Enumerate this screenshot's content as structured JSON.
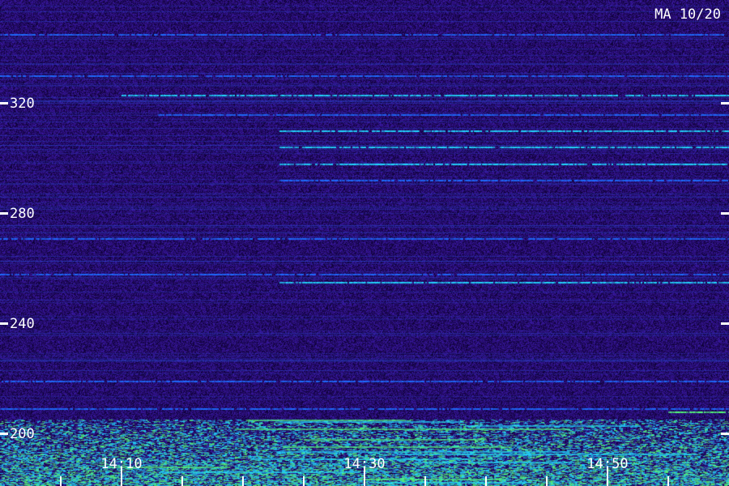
{
  "header": {
    "station_label": "MA 10/20"
  },
  "colors": {
    "background": "#20085a",
    "noise_dark": "#0a0030",
    "noise_light": "#3a1aa8",
    "band_blue": "#1e6cff",
    "band_cyan": "#22d8ff",
    "band_green": "#56ff7a",
    "axis": "#ffffff"
  },
  "chart_data": {
    "type": "heatmap",
    "title": "MA 10/20",
    "xlabel": "",
    "ylabel": "",
    "y_ticks": [
      200,
      240,
      280,
      320
    ],
    "y_range": [
      180,
      350
    ],
    "x_ticks": [
      "14:10",
      "14:30",
      "14:50"
    ],
    "x_range": [
      "14:00",
      "15:00"
    ],
    "x_minor_step_minutes": 5,
    "steady_lines": [
      {
        "freq": 345,
        "intensity": "blue",
        "start": "14:00",
        "end": "15:00"
      },
      {
        "freq": 330,
        "intensity": "blue",
        "start": "14:00",
        "end": "15:00"
      },
      {
        "freq": 323,
        "intensity": "cyan",
        "start": "14:10",
        "end": "15:00"
      },
      {
        "freq": 316,
        "intensity": "blue",
        "start": "14:13",
        "end": "15:00"
      },
      {
        "freq": 310,
        "intensity": "cyan",
        "start": "14:23",
        "end": "15:00"
      },
      {
        "freq": 304,
        "intensity": "cyan",
        "start": "14:23",
        "end": "15:00"
      },
      {
        "freq": 298,
        "intensity": "cyan",
        "start": "14:23",
        "end": "15:00"
      },
      {
        "freq": 292,
        "intensity": "blue",
        "start": "14:23",
        "end": "15:00"
      },
      {
        "freq": 271,
        "intensity": "blue",
        "start": "14:00",
        "end": "15:00"
      },
      {
        "freq": 258,
        "intensity": "blue",
        "start": "14:00",
        "end": "15:00"
      },
      {
        "freq": 255,
        "intensity": "cyan",
        "start": "14:23",
        "end": "15:00"
      },
      {
        "freq": 219,
        "intensity": "blue",
        "start": "14:00",
        "end": "15:00"
      },
      {
        "freq": 209,
        "intensity": "blue",
        "start": "14:00",
        "end": "15:00"
      },
      {
        "freq": 208,
        "intensity": "green",
        "start": "14:55",
        "end": "15:00"
      }
    ],
    "noisy_band": {
      "freq_low": 180,
      "freq_high": 205,
      "colors": [
        "cyan",
        "green"
      ]
    }
  }
}
